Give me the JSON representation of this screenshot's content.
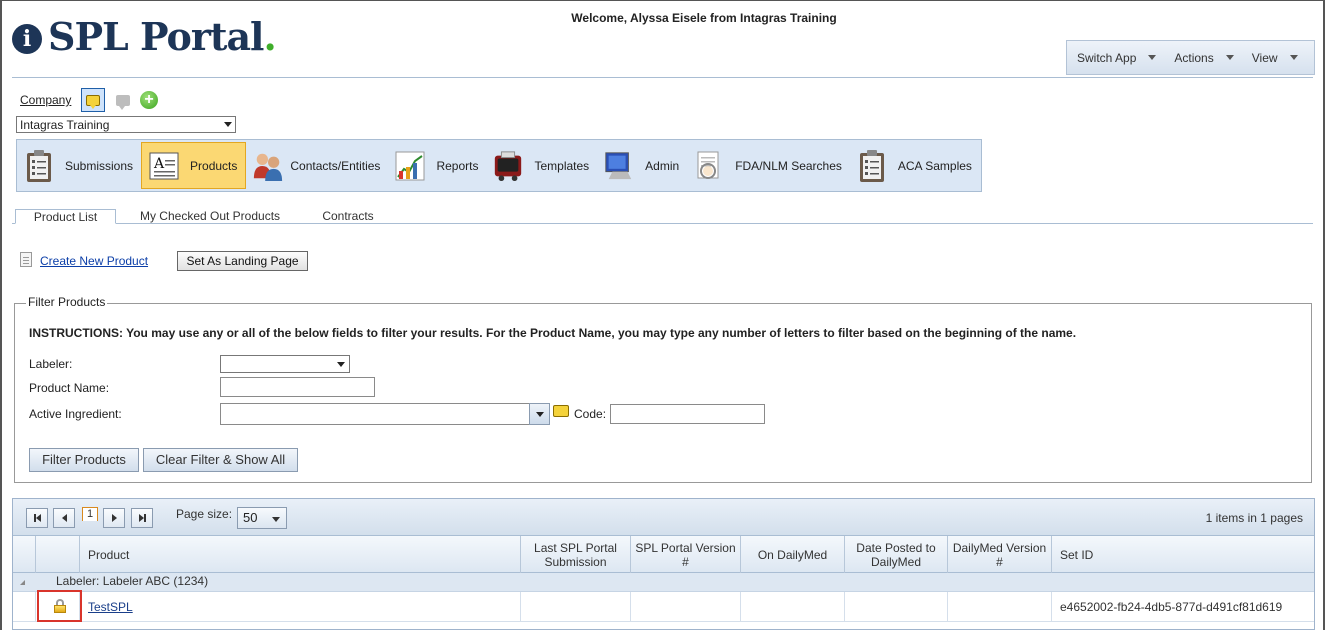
{
  "header": {
    "logo_text": "SPL Portal",
    "logo_dot": ".",
    "logo_badge": "i",
    "welcome": "Welcome, Alyssa Eisele from Intagras Training",
    "menu": [
      "Switch App",
      "Actions",
      "View"
    ]
  },
  "company": {
    "label": "Company",
    "selected": "Intagras Training",
    "add_symbol": "+"
  },
  "nav": {
    "items": [
      "Submissions",
      "Products",
      "Contacts/Entities",
      "Reports",
      "Templates",
      "Admin",
      "FDA/NLM Searches",
      "ACA Samples"
    ],
    "active": "Products"
  },
  "tabs": [
    "Product List",
    "My Checked Out Products",
    "Contracts"
  ],
  "actions": {
    "create_link": "Create New Product",
    "landing_button": "Set As Landing Page"
  },
  "filter": {
    "legend": "Filter Products",
    "instructions": "INSTRUCTIONS: You may use any or all of the below fields to filter your results. For the Product Name, you may type any number of letters to filter based on the beginning of the name.",
    "labeler_label": "Labeler:",
    "product_name_label": "Product Name:",
    "active_ingredient_label": "Active Ingredient:",
    "code_label": "Code:",
    "labeler_value": "",
    "product_name_value": "",
    "active_ingredient_value": "",
    "code_value": "",
    "filter_button": "Filter Products",
    "clear_button": "Clear Filter & Show All"
  },
  "grid": {
    "current_page": "1",
    "page_size_label": "Page size:",
    "page_size": "50",
    "page_info": "1 items in 1 pages",
    "columns": [
      "",
      "",
      "Product",
      "Last SPL Portal Submission",
      "SPL Portal Version #",
      "On DailyMed",
      "Date Posted to DailyMed",
      "DailyMed Version #",
      "Set ID"
    ],
    "group_label": "Labeler: Labeler ABC (1234)",
    "rows": [
      {
        "product": "TestSPL",
        "last_submission": "",
        "portal_version": "",
        "on_dailymed": "",
        "date_posted": "",
        "dailymed_version": "",
        "set_id": "e4652002-fb24-4db5-877d-d491cf81d619"
      }
    ]
  },
  "colors": {
    "brand_navy": "#1d3557",
    "brand_green": "#3fae2a",
    "active_nav": "#fbd873",
    "highlight_red": "#d9342b"
  }
}
